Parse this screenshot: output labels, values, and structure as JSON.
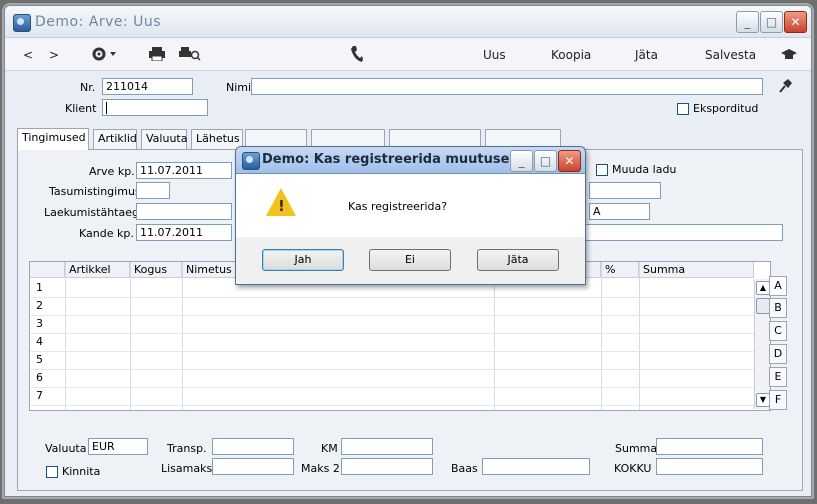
{
  "window": {
    "title": "Demo: Arve: Uus"
  },
  "toolbar": {
    "back": "<",
    "forward": ">",
    "actions": [
      "Uus",
      "Koopia",
      "Jäta",
      "Salvesta"
    ]
  },
  "header": {
    "nr_label": "Nr.",
    "nr_value": "211014",
    "nimi_label": "Nimi",
    "nimi_value": "",
    "klient_label": "Klient",
    "klient_value": "",
    "eksporditud_label": "Eksporditud"
  },
  "tabs": [
    "Tingimused",
    "Artiklid",
    "Valuuta",
    "Lähetus"
  ],
  "tingimused": {
    "arve_kp_label": "Arve kp.",
    "arve_kp_value": "11.07.2011",
    "tasumistingimus_label": "Tasumistingimus",
    "tasumistingimus_value": "",
    "laekumistahtaeg_label": "Laekumistähtaeg",
    "laekumistahtaeg_value": "",
    "kande_kp_label": "Kande kp.",
    "kande_kp_value": "11.07.2011",
    "muuda_ladu_label": "Muuda ladu",
    "right_field_a": "A"
  },
  "grid": {
    "columns": [
      "Artikkel",
      "Kogus",
      "Nimetus",
      "%",
      "Summa"
    ],
    "rows": [
      "1",
      "2",
      "3",
      "4",
      "5",
      "6",
      "7"
    ]
  },
  "side_tabs": [
    "A",
    "B",
    "C",
    "D",
    "E",
    "F"
  ],
  "footer": {
    "valuuta_label": "Valuuta",
    "valuuta_value": "EUR",
    "transp_label": "Transp.",
    "km_label": "KM",
    "summa_label": "Summa",
    "kinnita_label": "Kinnita",
    "lisamaks_label": "Lisamaks",
    "maks2_label": "Maks 2",
    "baas_label": "Baas",
    "kokku_label": "KOKKU"
  },
  "dialog": {
    "title": "Demo: Kas registreerida muutused?",
    "message": "Kas registreerida?",
    "buttons": {
      "yes": "Jah",
      "no": "Ei",
      "cancel": "Jäta"
    }
  },
  "colors": {
    "accent": "#3c7fb1",
    "warning": "#f2c11c",
    "close": "#c8432b"
  }
}
